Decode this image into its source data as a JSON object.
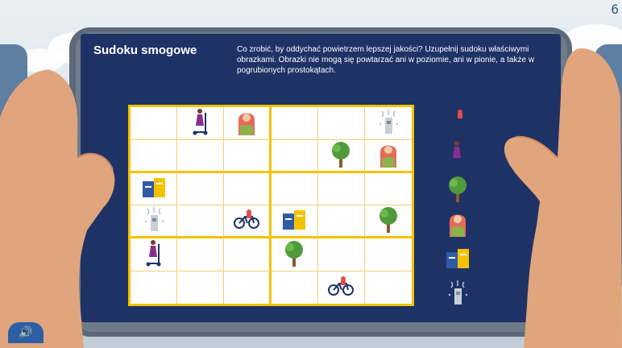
{
  "app": {
    "title": "Sudoku smogowe",
    "instructions": "Co zrobić, by oddychać powietrzem lepszej jakości? Uzupełnij sudoku właściwymi obrazkami. Obrazki nie mogą się powtarzać ani w poziomie, ani w pionie, a także w pogrubionych prostokątach."
  },
  "navigation": {
    "prev_icon": "arrow-left-icon",
    "next_icon": "arrow-right-icon",
    "prev_label": "←",
    "next_label": "→"
  },
  "corner": {
    "label": "6"
  },
  "sound": {
    "icon": "speaker-icon",
    "label": "🔊"
  },
  "colors": {
    "screen": "#1f3266",
    "grid_border": "#f3c300",
    "frame": "#6e7b89"
  },
  "sudoku": {
    "rows": [
      [
        "",
        "scooter",
        "woman",
        "",
        "",
        "purifier"
      ],
      [
        "",
        "",
        "",
        "",
        "tree",
        "woman"
      ],
      [
        "recycling-bins",
        "",
        "",
        "",
        "",
        ""
      ],
      [
        "purifier",
        "",
        "bicycle",
        "recycling-bins",
        "",
        "tree"
      ],
      [
        "scooter",
        "",
        "",
        "tree",
        "",
        ""
      ],
      [
        "",
        "",
        "",
        "",
        "bicycle",
        ""
      ]
    ]
  },
  "palette": [
    "bicycle",
    "scooter",
    "tree",
    "woman",
    "recycling-bins",
    "purifier"
  ]
}
